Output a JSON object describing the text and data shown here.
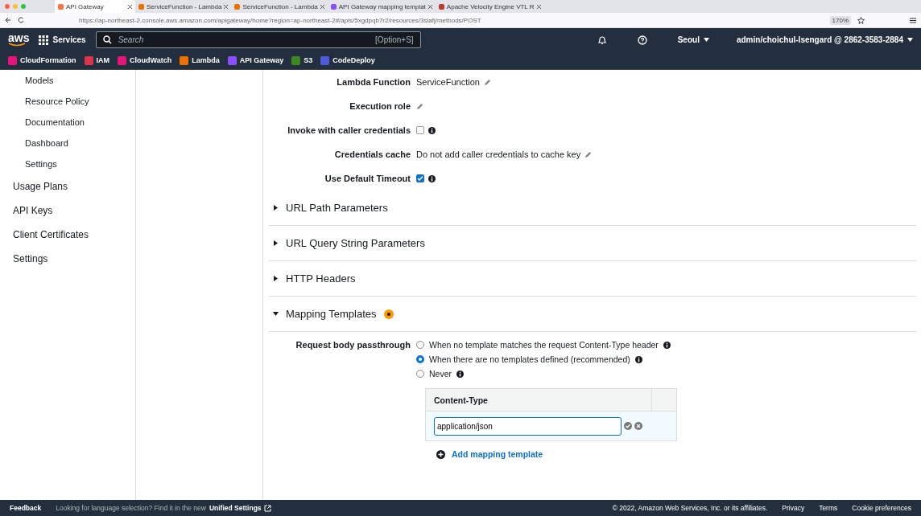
{
  "browser": {
    "tabs": [
      {
        "label": "API Gateway",
        "selected": true
      },
      {
        "label": "ServiceFunction - Lambda",
        "selected": false
      },
      {
        "label": "ServiceFunction - Lambda",
        "selected": false
      },
      {
        "label": "API Gateway mapping templat",
        "selected": false
      },
      {
        "label": "Apache Velocity Engine VTL R",
        "selected": false
      }
    ],
    "url": "https://ap-northeast-2.console.aws.amazon.com/apigateway/home?region=ap-northeast-2#/apis/5xgdpqb7r2/resources/3slafj/methods/POST",
    "zoom": "170%"
  },
  "topnav": {
    "logo": "aws",
    "services": "Services",
    "search_placeholder": "Search",
    "search_shortcut": "[Option+S]",
    "region": "Seoul",
    "account": "admin/choichul-Isengard @ 2862-3583-2884"
  },
  "favorites": [
    {
      "label": "CloudFormation",
      "color": "#e7157b"
    },
    {
      "label": "IAM",
      "color": "#dd344c"
    },
    {
      "label": "CloudWatch",
      "color": "#e7157b"
    },
    {
      "label": "Lambda",
      "color": "#ed7100"
    },
    {
      "label": "API Gateway",
      "color": "#8c4fff"
    },
    {
      "label": "S3",
      "color": "#3f8624"
    },
    {
      "label": "CodeDeploy",
      "color": "#4d5bd9"
    }
  ],
  "sidebar": {
    "items": [
      {
        "label": "Models",
        "sub": true
      },
      {
        "label": "Resource Policy",
        "sub": true
      },
      {
        "label": "Documentation",
        "sub": true
      },
      {
        "label": "Dashboard",
        "sub": true
      },
      {
        "label": "Settings",
        "sub": true
      },
      {
        "label": "Usage Plans",
        "sub": false
      },
      {
        "label": "API Keys",
        "sub": false
      },
      {
        "label": "Client Certificates",
        "sub": false
      },
      {
        "label": "Settings",
        "sub": false
      }
    ]
  },
  "fields": [
    {
      "label": "Lambda Function",
      "kind": "text",
      "value": "ServiceFunction"
    },
    {
      "label": "Execution role",
      "kind": "edit"
    },
    {
      "label": "Invoke with caller credentials",
      "kind": "checkbox",
      "checked": false
    },
    {
      "label": "Credentials cache",
      "kind": "text",
      "value": "Do not add caller credentials to cache key"
    },
    {
      "label": "Use Default Timeout",
      "kind": "checkbox",
      "checked": true
    }
  ],
  "sections": [
    {
      "title": "URL Path Parameters",
      "expanded": false
    },
    {
      "title": "URL Query String Parameters",
      "expanded": false
    },
    {
      "title": "HTTP Headers",
      "expanded": false
    },
    {
      "title": "Mapping Templates",
      "expanded": true,
      "badge": true
    }
  ],
  "mapping": {
    "passthrough_label": "Request body passthrough",
    "options": [
      {
        "label": "When no template matches the request Content-Type header",
        "selected": false,
        "info": true
      },
      {
        "label": "When there are no templates defined (recommended)",
        "selected": true,
        "info": true
      },
      {
        "label": "Never",
        "selected": false,
        "info": true
      }
    ],
    "table_header": "Content-Type",
    "content_type_value": "application/json",
    "add_link": "Add mapping template"
  },
  "footer": {
    "feedback": "Feedback",
    "language_note": "Looking for language selection? Find it in the new",
    "unified_settings": "Unified Settings",
    "copyright": "© 2022, Amazon Web Services, Inc. or its affiliates.",
    "links": [
      "Privacy",
      "Terms",
      "Cookie preferences"
    ]
  }
}
